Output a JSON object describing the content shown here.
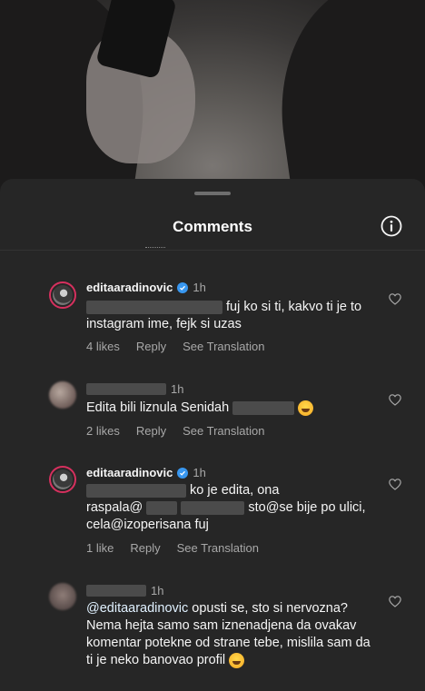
{
  "sheet": {
    "title": "Comments"
  },
  "comments": [
    {
      "username": "editaaradinovic",
      "time": "1h",
      "text": "fuj ko si ti, kakvo ti je to instagram ime, fejk si uzas",
      "likes": "4 likes",
      "reply": "Reply",
      "translation": "See Translation"
    },
    {
      "time": "1h",
      "text_a": "Edita bili liznula Senidah",
      "likes": "2 likes",
      "reply": "Reply",
      "translation": "See Translation"
    },
    {
      "username": "editaaradinovic",
      "time": "1h",
      "text_a": "ko je edita, ona",
      "text_b": "raspala@",
      "text_c": "sto@se bije po ulici,",
      "text_d": "cela@izoperisana fuj",
      "likes": "1 like",
      "reply": "Reply",
      "translation": "See Translation"
    },
    {
      "time": "1h",
      "mention": "@editaaradinovic",
      "text": "opusti se, sto si nervozna? Nema hejta samo sam iznenadjena da ovakav komentar potekne od strane tebe, mislila sam da ti je neko banovao profil"
    }
  ],
  "colors": {
    "sheet": "#262626",
    "muted": "#a8a8a8",
    "verified": "#3897f0",
    "story_ring": "#d6305e"
  }
}
